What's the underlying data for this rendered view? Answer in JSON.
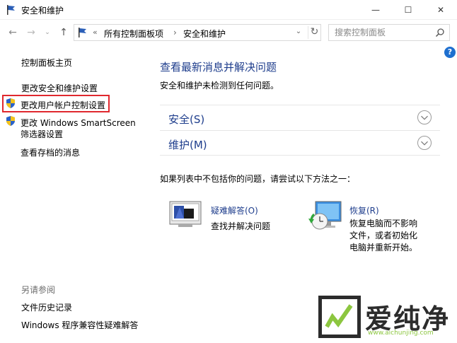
{
  "window": {
    "title": "安全和维护",
    "minimize_glyph": "—",
    "maximize_glyph": "☐",
    "close_glyph": "✕"
  },
  "nav": {
    "back_icon": "arrow-left-icon",
    "forward_icon": "arrow-right-icon",
    "up_icon": "arrow-up-icon",
    "back_glyph": "←",
    "forward_glyph": "→",
    "recent_glyph": "⌄",
    "up_glyph": "↑"
  },
  "address": {
    "prefix": "«",
    "crumbs": [
      "所有控制面板项",
      "安全和维护"
    ],
    "separator": "›",
    "dropdown_glyph": "⌄",
    "refresh_glyph": "↻"
  },
  "search": {
    "placeholder": "搜索控制面板"
  },
  "help": {
    "label": "?"
  },
  "sidebar": {
    "home": "控制面板主页",
    "items": [
      "更改安全和维护设置",
      "更改用户帐户控制设置",
      "更改 Windows SmartScreen",
      "筛选器设置",
      "查看存档的消息"
    ],
    "see_also": "另请参阅",
    "see_also_items": [
      "文件历史记录",
      "Windows 程序兼容性疑难解答"
    ]
  },
  "main": {
    "title": "查看最新消息并解决问题",
    "subtitle": "安全和维护未检测到任何问题。",
    "sections": [
      {
        "label": "安全(S)"
      },
      {
        "label": "维护(M)"
      }
    ],
    "try_text": "如果列表中不包括你的问题，请尝试以下方法之一：",
    "troubleshoot": {
      "title": "疑难解答(O)",
      "desc": "查找并解决问题"
    },
    "recovery": {
      "title": "恢复(R)",
      "desc": "恢复电脑而不影响文件，或者初始化电脑并重新开始。"
    }
  },
  "watermark": {
    "text": "爱纯净",
    "url": "www.aichunjing.com"
  },
  "colors": {
    "link_blue": "#1e3d8c",
    "highlight_red": "#e0282e",
    "watermark_green": "#8cc63f"
  }
}
